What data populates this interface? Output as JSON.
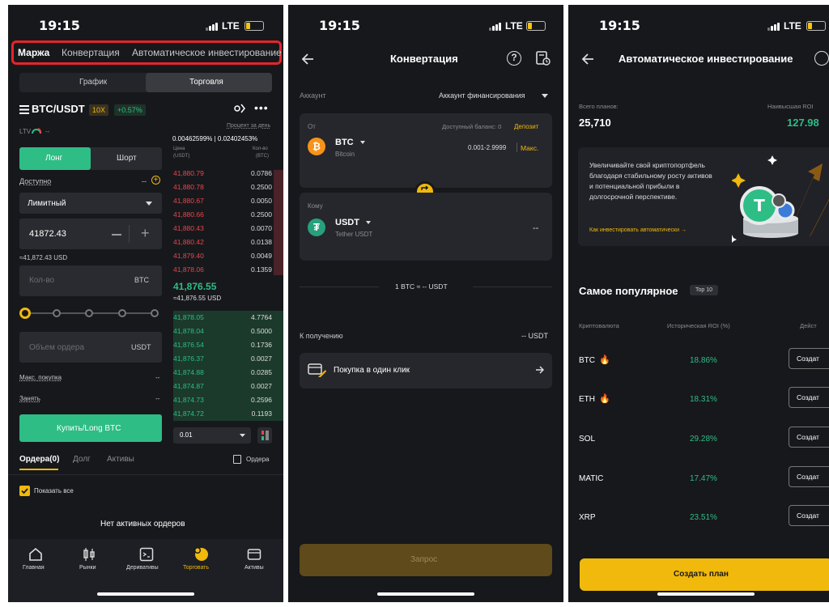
{
  "status": {
    "time": "19:15",
    "network": "LTE"
  },
  "screen1": {
    "top_tabs": [
      "Маржа",
      "Конвертация",
      "Автоматическое инвестирование"
    ],
    "mode_tabs": [
      "График",
      "Торговля"
    ],
    "pair": "BTC/USDT",
    "leverage": "10X",
    "change": "+0.57%",
    "ltv_label": "LTV",
    "ltv_value": "--",
    "rate_header": "Процент за день",
    "rate_value": "0.00462599% | 0.02402453%",
    "col_price": "Цена",
    "col_price_unit": "(USDT)",
    "col_qty": "Кол-во",
    "col_qty_unit": "(BTC)",
    "long": "Лонг",
    "short": "Шорт",
    "available": "Доступно",
    "available_value": "--",
    "order_type": "Лимитный",
    "price_input": "41872.43",
    "price_usd": "≈41,872.43 USD",
    "qty_placeholder": "Кол-во",
    "qty_unit": "BTC",
    "volume_placeholder": "Объем ордера",
    "volume_unit": "USDT",
    "max_buy": "Макс. покупка",
    "max_buy_value": "--",
    "borrow": "Занять",
    "borrow_value": "--",
    "buy_button": "Купить/Long BTC",
    "asks": [
      {
        "price": "41,880.79",
        "qty": "0.0786"
      },
      {
        "price": "41,880.78",
        "qty": "0.2500"
      },
      {
        "price": "41,880.67",
        "qty": "0.0050"
      },
      {
        "price": "41,880.66",
        "qty": "0.2500"
      },
      {
        "price": "41,880.43",
        "qty": "0.0070"
      },
      {
        "price": "41,880.42",
        "qty": "0.0138"
      },
      {
        "price": "41,879.40",
        "qty": "0.0049"
      },
      {
        "price": "41,878.06",
        "qty": "0.1359"
      }
    ],
    "last_price": "41,876.55",
    "last_price_usd": "≈41,876.55 USD",
    "bids": [
      {
        "price": "41,878.05",
        "qty": "4.7764"
      },
      {
        "price": "41,878.04",
        "qty": "0.5000"
      },
      {
        "price": "41,876.54",
        "qty": "0.1736"
      },
      {
        "price": "41,876.37",
        "qty": "0.0027"
      },
      {
        "price": "41,874.88",
        "qty": "0.0285"
      },
      {
        "price": "41,874.87",
        "qty": "0.0027"
      },
      {
        "price": "41,874.73",
        "qty": "0.2596"
      },
      {
        "price": "41,874.72",
        "qty": "0.1193"
      }
    ],
    "depth_select": "0.01",
    "order_tabs": [
      "Ордера(0)",
      "Долг",
      "Активы"
    ],
    "orders_link": "Ордера",
    "show_all": "Показать все",
    "no_orders": "Нет активных ордеров",
    "bottom_nav": [
      "Главная",
      "Рынки",
      "Деривативы",
      "Торговать",
      "Активы"
    ]
  },
  "screen2": {
    "title": "Конвертация",
    "account_label": "Аккаунт",
    "account_value": "Аккаунт финансирования",
    "from_label": "От",
    "balance_label": "Доступный баланс: 0",
    "deposit": "Депозит",
    "from_coin": "BTC",
    "from_coin_name": "Bitcoin",
    "from_range": "0.001-2.9999",
    "max": "Макс.",
    "to_label": "Кому",
    "to_coin": "USDT",
    "to_coin_name": "Tether USDT",
    "to_value": "--",
    "rate": "1 BTC ≈ -- USDT",
    "receive_label": "К получению",
    "receive_value": "-- USDT",
    "one_click": "Покупка в один клик",
    "request_button": "Запрос"
  },
  "screen3": {
    "title": "Автоматическое инвестирование",
    "total_plans_label": "Всего планов:",
    "total_plans": "25,710",
    "max_roi_label": "Наивысшая ROI",
    "max_roi": "127.98",
    "promo_text": "Увеличивайте свой криптопортфель благодаря стабильному росту активов и потенциальной прибыли в долгосрочной перспективе.",
    "promo_link": "Как инвестировать автоматически →",
    "popular": "Самое популярное",
    "top_badge": "Top 10",
    "col_crypto": "Криптовалюта",
    "col_roi": "Историческая ROI (%)",
    "col_action": "Дейст",
    "rows": [
      {
        "coin": "BTC",
        "roi": "18.86%",
        "hot": true
      },
      {
        "coin": "ETH",
        "roi": "18.31%",
        "hot": true
      },
      {
        "coin": "SOL",
        "roi": "29.28%",
        "hot": false
      },
      {
        "coin": "MATIC",
        "roi": "17.47%",
        "hot": false
      },
      {
        "coin": "XRP",
        "roi": "23.51%",
        "hot": false
      }
    ],
    "create_small": "Создат",
    "create_plan": "Создать план"
  }
}
